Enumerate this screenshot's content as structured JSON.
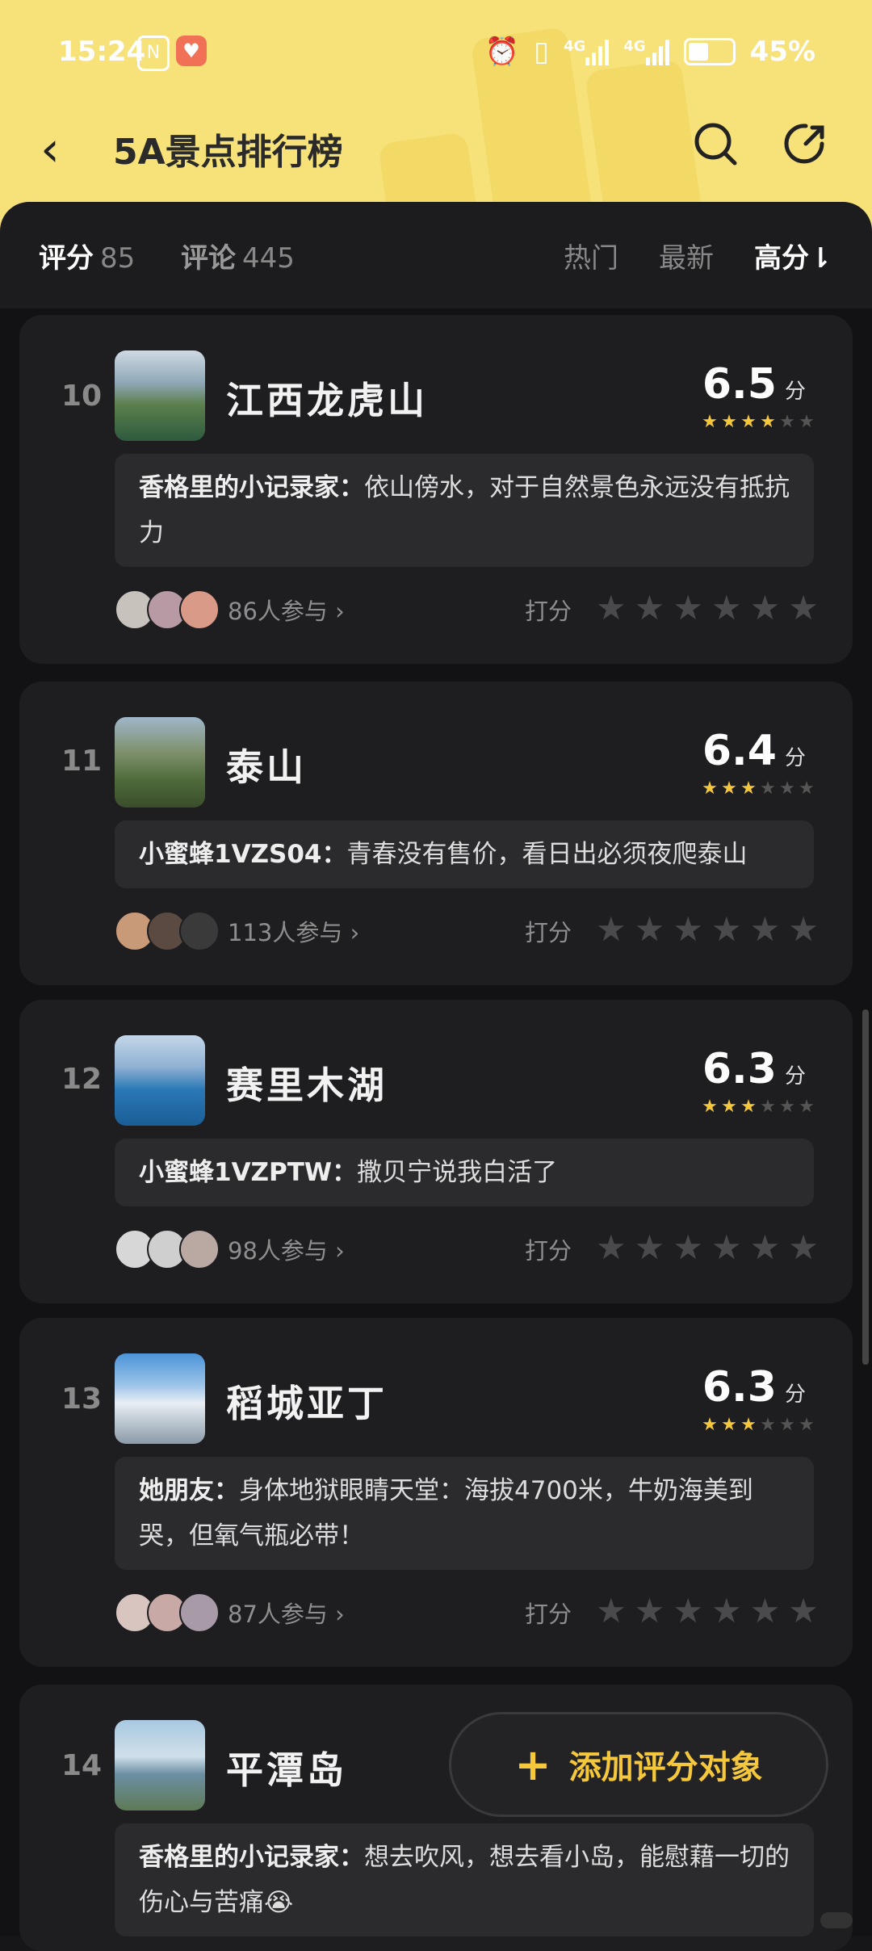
{
  "status_bar": {
    "time": "15:24",
    "nfc": "N",
    "battery": "45%",
    "network1": "4G",
    "network2": "4G"
  },
  "nav": {
    "title": "5A景点排行榜"
  },
  "tabs": {
    "score_label": "评分",
    "score_count": "85",
    "review_label": "评论",
    "review_count": "445",
    "hot": "热门",
    "newest": "最新",
    "high": "高分⇂"
  },
  "items": [
    {
      "rank": "10",
      "name": "江西龙虎山",
      "score": "6.5",
      "unit": "分",
      "stars": 3.5,
      "comment_user": "香格里的小记录家：",
      "comment_text": "依山傍水，对于自然景色永远没有抵抗力",
      "participants": "86人参与 ›",
      "rate_label": "打分"
    },
    {
      "rank": "11",
      "name": "泰山",
      "score": "6.4",
      "unit": "分",
      "stars": 3,
      "comment_user": "小蜜蜂1VZS04：",
      "comment_text": "青春没有售价，看日出必须夜爬泰山",
      "participants": "113人参与 ›",
      "rate_label": "打分"
    },
    {
      "rank": "12",
      "name": "赛里木湖",
      "score": "6.3",
      "unit": "分",
      "stars": 3,
      "comment_user": "小蜜蜂1VZPTW：",
      "comment_text": "撒贝宁说我白活了",
      "participants": "98人参与 ›",
      "rate_label": "打分"
    },
    {
      "rank": "13",
      "name": "稻城亚丁",
      "score": "6.3",
      "unit": "分",
      "stars": 3,
      "comment_user": "她朋友：",
      "comment_text": "身体地狱眼睛天堂：海拔4700米，牛奶海美到哭，但氧气瓶必带！",
      "participants": "87人参与 ›",
      "rate_label": "打分"
    },
    {
      "rank": "14",
      "name": "平潭岛",
      "score": "",
      "unit": "",
      "stars": 0,
      "comment_user": "香格里的小记录家：",
      "comment_text": "想去吹风，想去看小岛，能慰藉一切的伤心与苦痛😭",
      "participants": "",
      "rate_label": ""
    }
  ],
  "fab": {
    "label": "添加评分对象",
    "plus": "+"
  },
  "colors": {
    "accent": "#f5c73a",
    "header": "#f7e27a",
    "background": "#121214",
    "card": "#1e1e21"
  }
}
